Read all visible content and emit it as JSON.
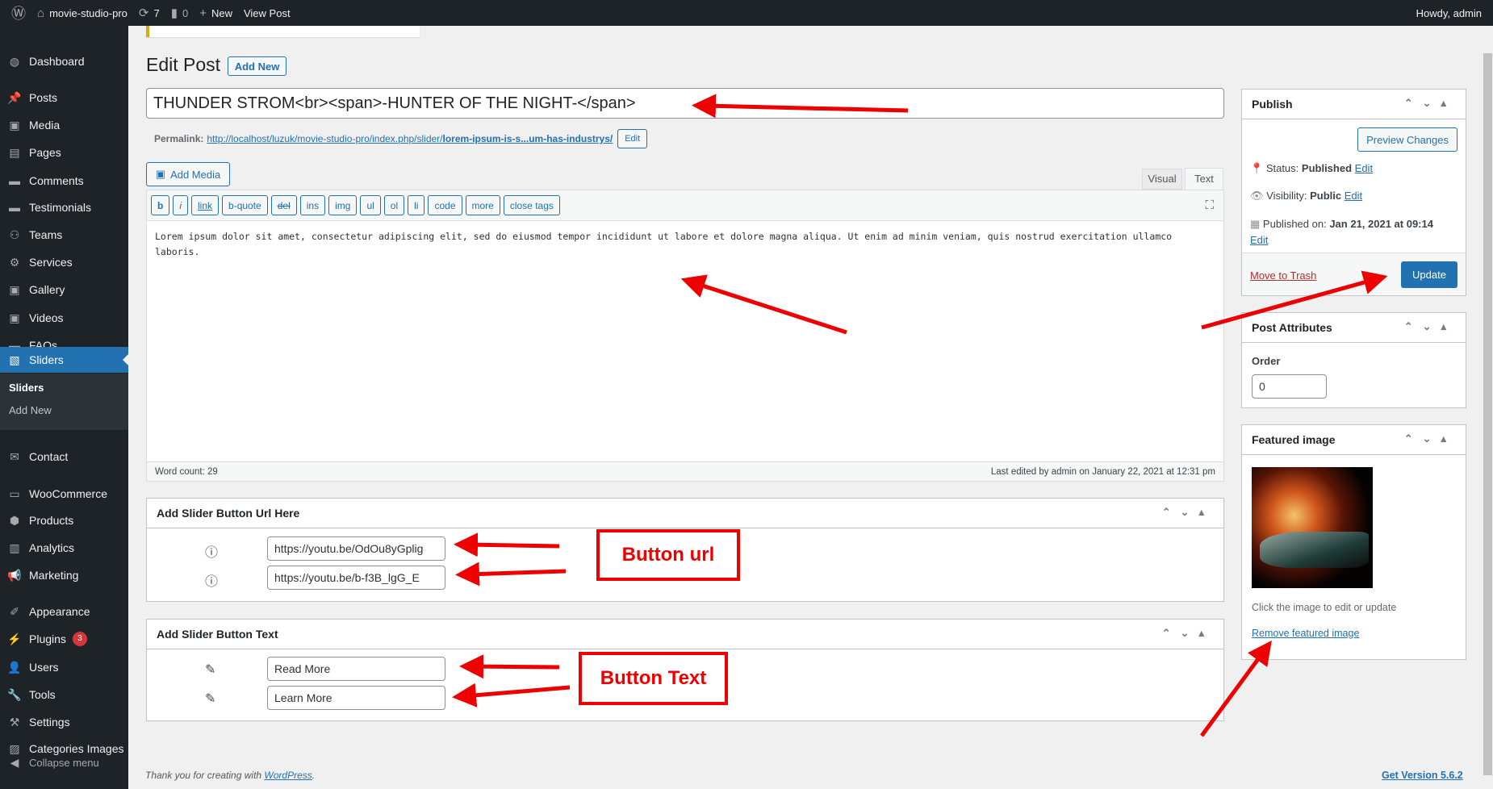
{
  "adminbar": {
    "site": "movie-studio-pro",
    "updates": "7",
    "comments": "0",
    "new": "New",
    "view_post": "View Post",
    "howdy": "Howdy, admin"
  },
  "sidebar": {
    "items": [
      {
        "label": "Dashboard",
        "icon": "dashboard-icon"
      },
      {
        "label": "Posts",
        "icon": "pin-icon"
      },
      {
        "label": "Media",
        "icon": "media-icon"
      },
      {
        "label": "Pages",
        "icon": "pages-icon"
      },
      {
        "label": "Comments",
        "icon": "comment-icon"
      },
      {
        "label": "Testimonials",
        "icon": "comment-icon"
      },
      {
        "label": "Teams",
        "icon": "groups-icon"
      },
      {
        "label": "Services",
        "icon": "gear-icon"
      },
      {
        "label": "Gallery",
        "icon": "media-icon"
      },
      {
        "label": "Videos",
        "icon": "media-icon"
      },
      {
        "label": "FAQs",
        "icon": "comment-icon"
      },
      {
        "label": "Sliders",
        "icon": "slides-icon"
      },
      {
        "label": "Contact",
        "icon": "mail-icon"
      },
      {
        "label": "WooCommerce",
        "icon": "woo-icon"
      },
      {
        "label": "Products",
        "icon": "box-icon"
      },
      {
        "label": "Analytics",
        "icon": "bar-chart-icon"
      },
      {
        "label": "Marketing",
        "icon": "megaphone-icon"
      },
      {
        "label": "Appearance",
        "icon": "brush-icon"
      },
      {
        "label": "Plugins",
        "icon": "plugin-icon",
        "badge": "3"
      },
      {
        "label": "Users",
        "icon": "user-icon"
      },
      {
        "label": "Tools",
        "icon": "wrench-icon"
      },
      {
        "label": "Settings",
        "icon": "settings-icon"
      },
      {
        "label": "Categories Images",
        "icon": "image-icon"
      }
    ],
    "submenu": [
      "Sliders",
      "Add New"
    ],
    "collapse": "Collapse menu"
  },
  "header": {
    "title": "Edit Post",
    "add_new": "Add New"
  },
  "post": {
    "title": "THUNDER STROM<br><span>-HUNTER OF THE NIGHT-</span>",
    "permalink_label": "Permalink:",
    "permalink_base": "http://localhost/luzuk/movie-studio-pro/index.php/slider/",
    "permalink_slug": "lorem-ipsum-is-s...um-has-industrys/",
    "permalink_edit": "Edit"
  },
  "editor": {
    "add_media": "Add Media",
    "tab_visual": "Visual",
    "tab_text": "Text",
    "active_tab": "Text",
    "quicktags": [
      "b",
      "i",
      "link",
      "b-quote",
      "del",
      "ins",
      "img",
      "ul",
      "ol",
      "li",
      "code",
      "more",
      "close tags"
    ],
    "content": "Lorem ipsum dolor sit amet, consectetur adipiscing elit, sed do eiusmod tempor incididunt ut labore et dolore magna aliqua. Ut enim ad minim veniam, quis nostrud exercitation ullamco laboris.",
    "word_count": "Word count: 29",
    "last_edited": "Last edited by admin on January 22, 2021 at 12:31 pm"
  },
  "url_box": {
    "title": "Add Slider Button Url Here",
    "fields": [
      "https://youtu.be/OdOu8yGplig",
      "https://youtu.be/b-f3B_lgG_E"
    ]
  },
  "text_box": {
    "title": "Add Slider Button Text",
    "fields": [
      "Read More",
      "Learn More"
    ]
  },
  "annotations": {
    "button_url": "Button url",
    "button_text": "Button Text",
    "color": "#e00000"
  },
  "publish": {
    "title": "Publish",
    "preview": "Preview Changes",
    "status_label": "Status:",
    "status": "Published",
    "visibility_label": "Visibility:",
    "visibility": "Public",
    "published_label": "Published on:",
    "published": "Jan 21, 2021 at 09:14",
    "edit": "Edit",
    "trash": "Move to Trash",
    "update": "Update"
  },
  "attributes": {
    "title": "Post Attributes",
    "order_label": "Order",
    "order": "0"
  },
  "featured": {
    "title": "Featured image",
    "hint": "Click the image to edit or update",
    "remove": "Remove featured image"
  },
  "footer": {
    "thanks": "Thank you for creating with ",
    "wp": "WordPress",
    "version": "Get Version 5.6.2"
  },
  "colors": {
    "accent": "#2271b1",
    "sidebar": "#1d2327",
    "update_button": "#2271b1"
  }
}
